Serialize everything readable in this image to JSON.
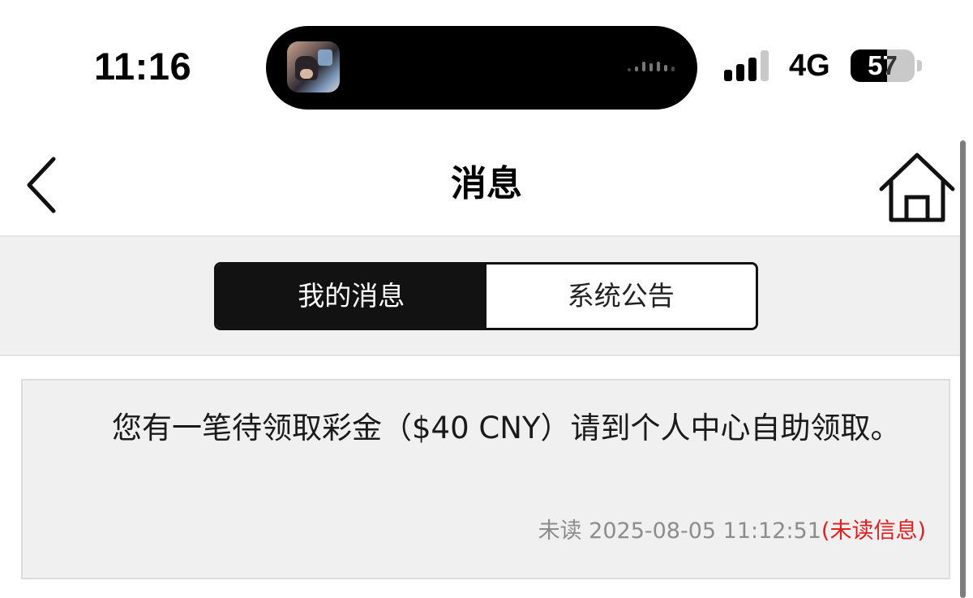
{
  "status_bar": {
    "time": "11:16",
    "network": "4G",
    "battery_level": "57",
    "signal_bars_active": 3,
    "signal_bars_total": 4
  },
  "nav": {
    "title": "消息",
    "back_icon": "chevron-left-icon",
    "home_icon": "home-icon"
  },
  "tabs": {
    "items": [
      {
        "label": "我的消息",
        "active": true
      },
      {
        "label": "系统公告",
        "active": false
      }
    ]
  },
  "messages": [
    {
      "text": "您有一笔待领取彩金（$40 CNY）请到个人中心自助领取。",
      "status": "未读",
      "timestamp": "2025-08-05 11:12:51",
      "unread_tag": "(未读信息)"
    }
  ],
  "colors": {
    "active_tab_bg": "#121212",
    "band_bg": "#f0f0f0",
    "unread_red": "#e02020",
    "meta_gray": "#8c8c8c"
  }
}
